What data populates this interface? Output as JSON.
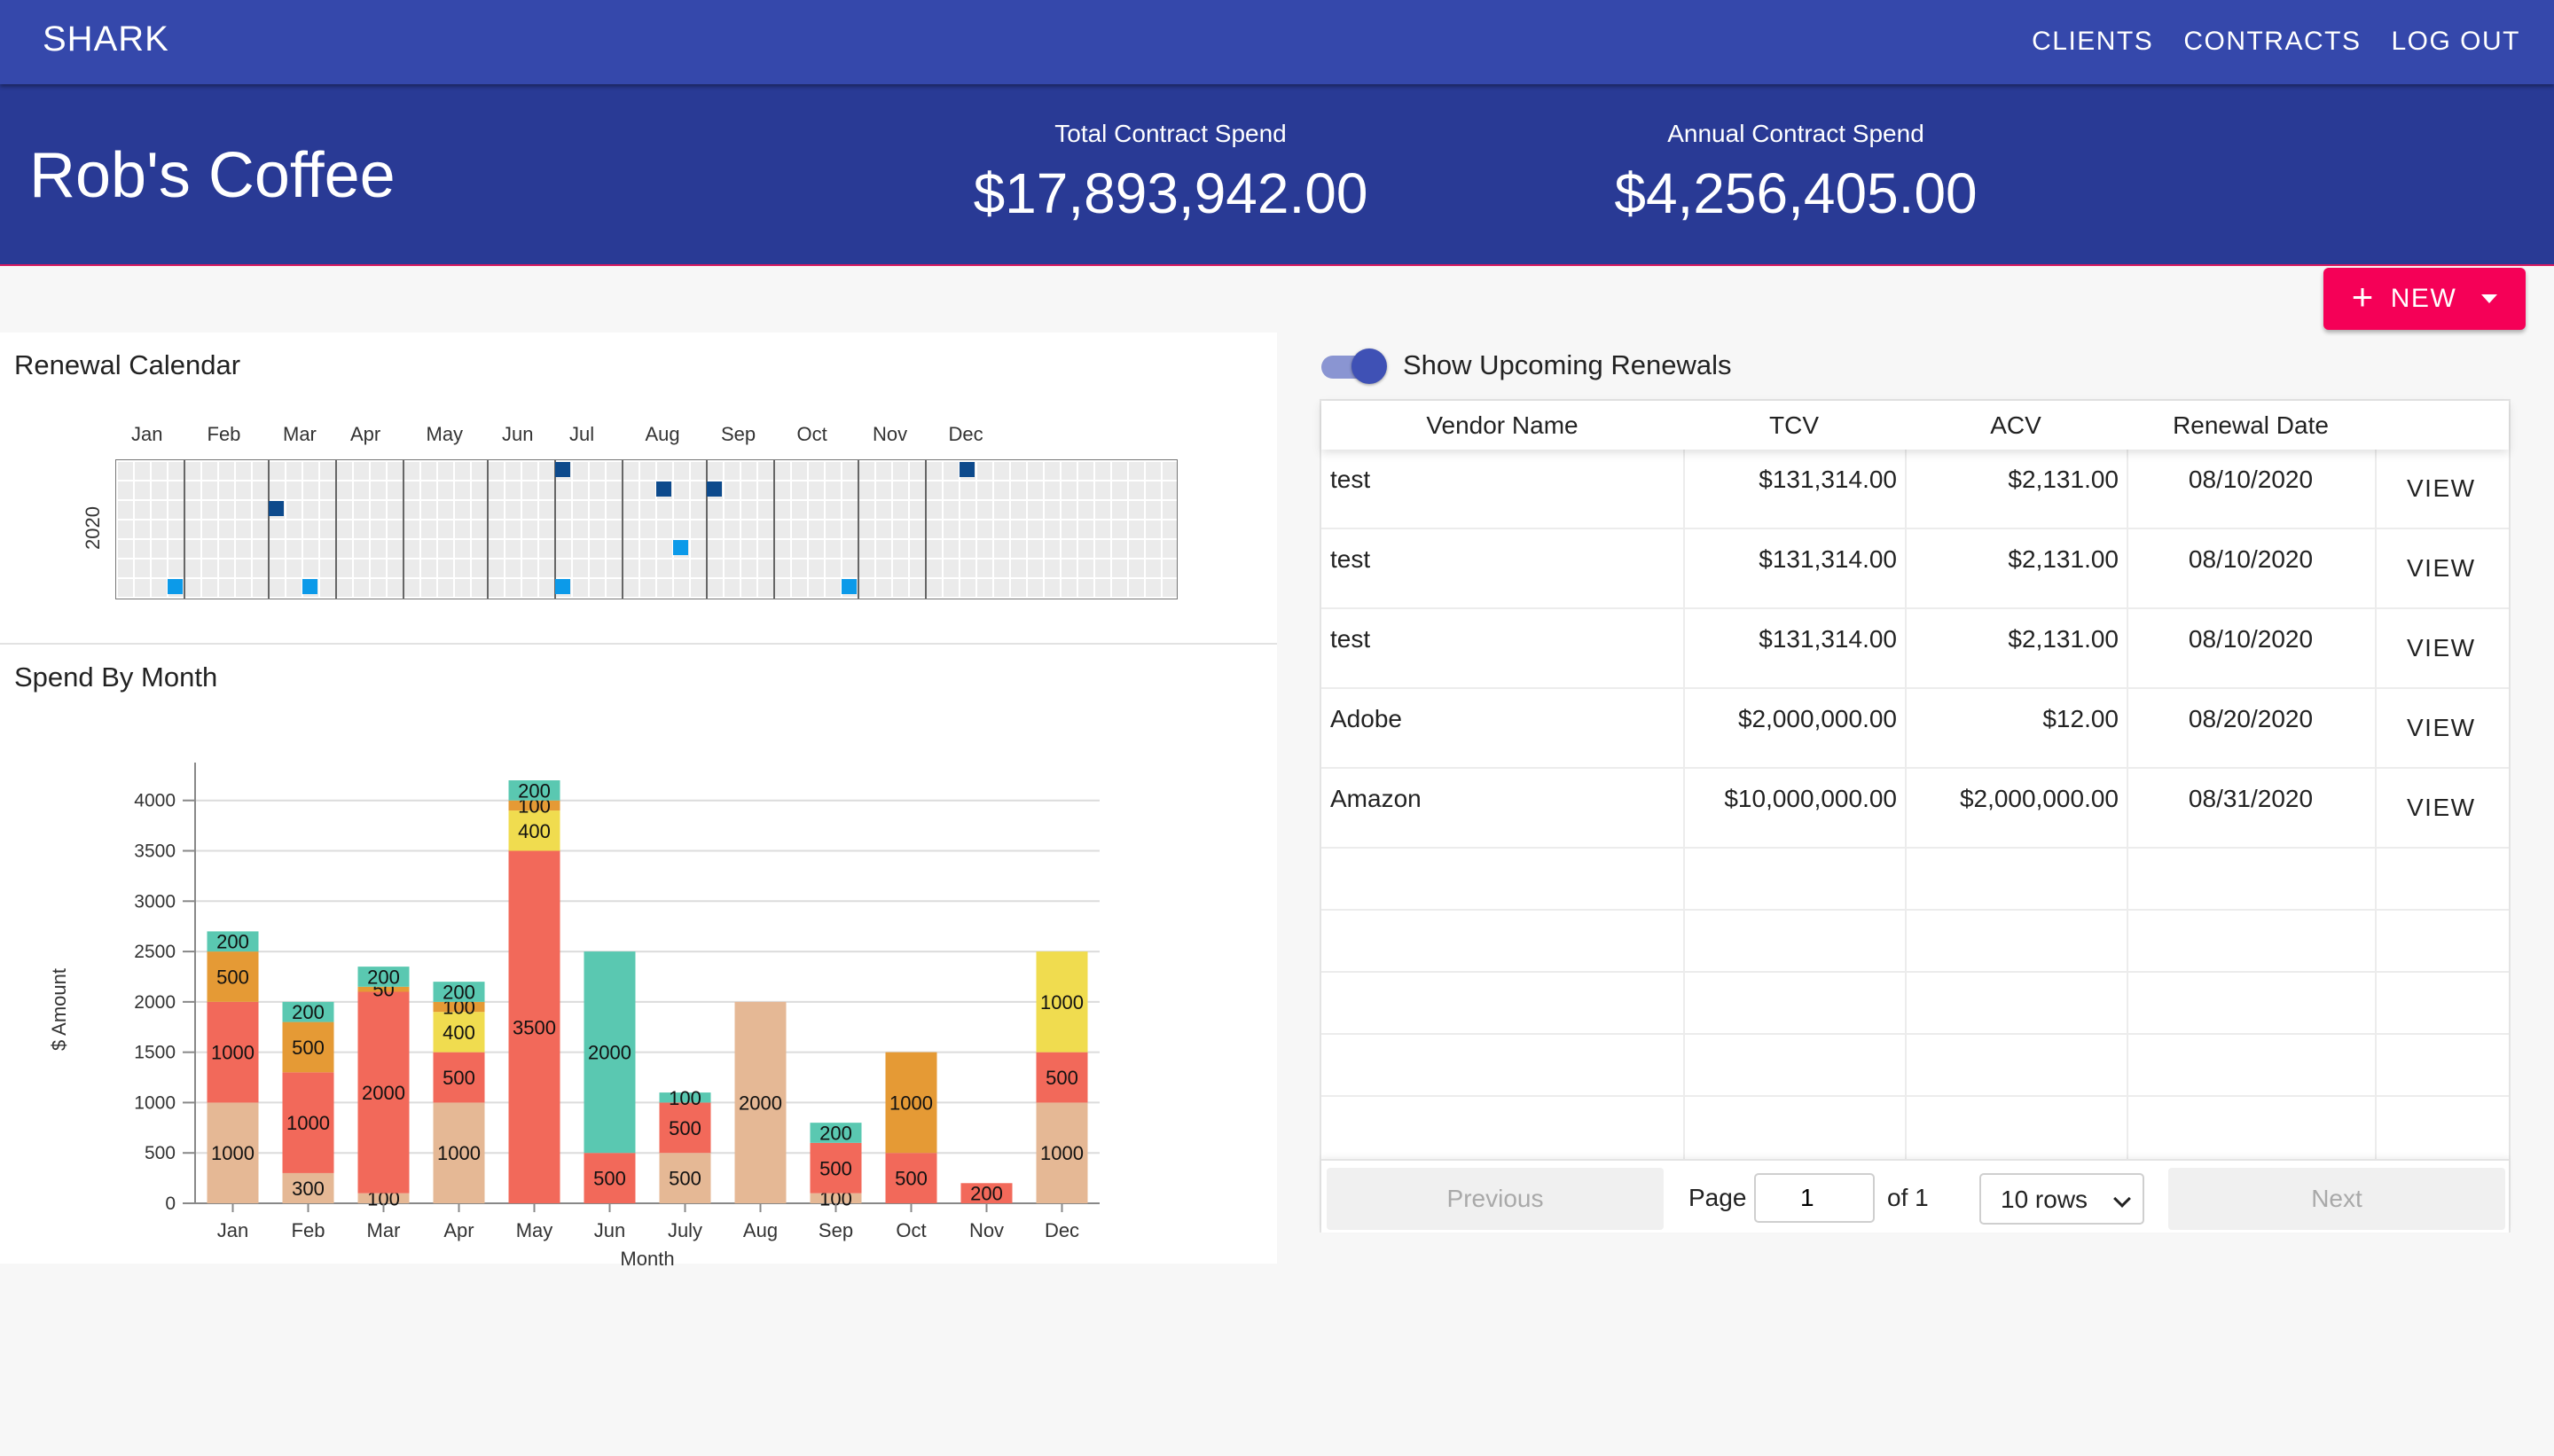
{
  "app": {
    "brand": "SHARK"
  },
  "nav": {
    "clients": "CLIENTS",
    "contracts": "CONTRACTS",
    "logout": "LOG OUT"
  },
  "client": {
    "name": "Rob's Coffee",
    "total_label": "Total Contract Spend",
    "total_value": "$17,893,942.00",
    "annual_label": "Annual Contract Spend",
    "annual_value": "$4,256,405.00"
  },
  "new_button": {
    "label": "NEW"
  },
  "calendar": {
    "title": "Renewal Calendar",
    "year": "2020",
    "months": [
      "Jan",
      "Feb",
      "Mar",
      "Apr",
      "May",
      "Jun",
      "Jul",
      "Aug",
      "Sep",
      "Oct",
      "Nov",
      "Dec"
    ],
    "colors": {
      "empty": "#ebebeb",
      "light": "#0c9ae9",
      "dark": "#0d4a8c"
    },
    "marked_dates": [
      "2020-01-25",
      "2020-03-03",
      "2020-03-21",
      "2020-06-28",
      "2020-07-04",
      "2020-08-10",
      "2020-08-20",
      "2020-08-31",
      "2020-10-31",
      "2020-12-13"
    ]
  },
  "chart_data": {
    "type": "bar",
    "title": "Spend By Month",
    "xlabel": "Month",
    "ylabel": "$ Amount",
    "ylim": [
      0,
      4200
    ],
    "yticks": [
      0,
      500,
      1000,
      1500,
      2000,
      2500,
      3000,
      3500,
      4000
    ],
    "categories": [
      "Jan",
      "Feb",
      "Mar",
      "Apr",
      "May",
      "Jun",
      "July",
      "Aug",
      "Sep",
      "Oct",
      "Nov",
      "Dec"
    ],
    "grid": true,
    "stacked": true,
    "stacks": [
      [
        {
          "value": 1000,
          "color": "#e5b895"
        },
        {
          "value": 1000,
          "color": "#f2695a"
        },
        {
          "value": 500,
          "color": "#e59a35"
        },
        {
          "value": 200,
          "color": "#5ac8b1"
        }
      ],
      [
        {
          "value": 300,
          "color": "#e5b895"
        },
        {
          "value": 1000,
          "color": "#f2695a"
        },
        {
          "value": 500,
          "color": "#e59a35"
        },
        {
          "value": 200,
          "color": "#5ac8b1"
        }
      ],
      [
        {
          "value": 100,
          "color": "#e5b895"
        },
        {
          "value": 2000,
          "color": "#f2695a"
        },
        {
          "value": 50,
          "color": "#e59a35"
        },
        {
          "value": 200,
          "color": "#5ac8b1"
        }
      ],
      [
        {
          "value": 1000,
          "color": "#e5b895"
        },
        {
          "value": 500,
          "color": "#f2695a"
        },
        {
          "value": 400,
          "color": "#f0dc4f"
        },
        {
          "value": 100,
          "color": "#e59a35"
        },
        {
          "value": 200,
          "color": "#5ac8b1"
        }
      ],
      [
        {
          "value": 3500,
          "color": "#f2695a"
        },
        {
          "value": 400,
          "color": "#f0dc4f"
        },
        {
          "value": 100,
          "color": "#e59a35"
        },
        {
          "value": 200,
          "color": "#5ac8b1"
        }
      ],
      [
        {
          "value": 500,
          "color": "#f2695a"
        },
        {
          "value": 2000,
          "color": "#5ac8b1"
        }
      ],
      [
        {
          "value": 500,
          "color": "#e5b895"
        },
        {
          "value": 500,
          "color": "#f2695a"
        },
        {
          "value": 100,
          "color": "#5ac8b1"
        }
      ],
      [
        {
          "value": 2000,
          "color": "#e5b895"
        }
      ],
      [
        {
          "value": 100,
          "color": "#e5b895"
        },
        {
          "value": 500,
          "color": "#f2695a"
        },
        {
          "value": 200,
          "color": "#5ac8b1"
        }
      ],
      [
        {
          "value": 500,
          "color": "#f2695a"
        },
        {
          "value": 1000,
          "color": "#e59a35"
        }
      ],
      [
        {
          "value": 200,
          "color": "#f2695a"
        }
      ],
      [
        {
          "value": 1000,
          "color": "#e5b895"
        },
        {
          "value": 500,
          "color": "#f2695a"
        },
        {
          "value": 1000,
          "color": "#f0dc4f"
        }
      ]
    ]
  },
  "renewals": {
    "toggle_label": "Show Upcoming Renewals",
    "toggle_on": true,
    "columns": [
      "Vendor Name",
      "TCV",
      "ACV",
      "Renewal Date",
      ""
    ],
    "rows": [
      {
        "vendor": "test",
        "tcv": "$131,314.00",
        "acv": "$2,131.00",
        "date": "08/10/2020",
        "action": "VIEW"
      },
      {
        "vendor": "test",
        "tcv": "$131,314.00",
        "acv": "$2,131.00",
        "date": "08/10/2020",
        "action": "VIEW"
      },
      {
        "vendor": "test",
        "tcv": "$131,314.00",
        "acv": "$2,131.00",
        "date": "08/10/2020",
        "action": "VIEW"
      },
      {
        "vendor": "Adobe",
        "tcv": "$2,000,000.00",
        "acv": "$12.00",
        "date": "08/20/2020",
        "action": "VIEW"
      },
      {
        "vendor": "Amazon",
        "tcv": "$10,000,000.00",
        "acv": "$2,000,000.00",
        "date": "08/31/2020",
        "action": "VIEW"
      }
    ],
    "pagination": {
      "previous": "Previous",
      "next": "Next",
      "page_label": "Page",
      "page_value": "1",
      "of_label": "of 1",
      "rows_select": "10 rows"
    }
  }
}
